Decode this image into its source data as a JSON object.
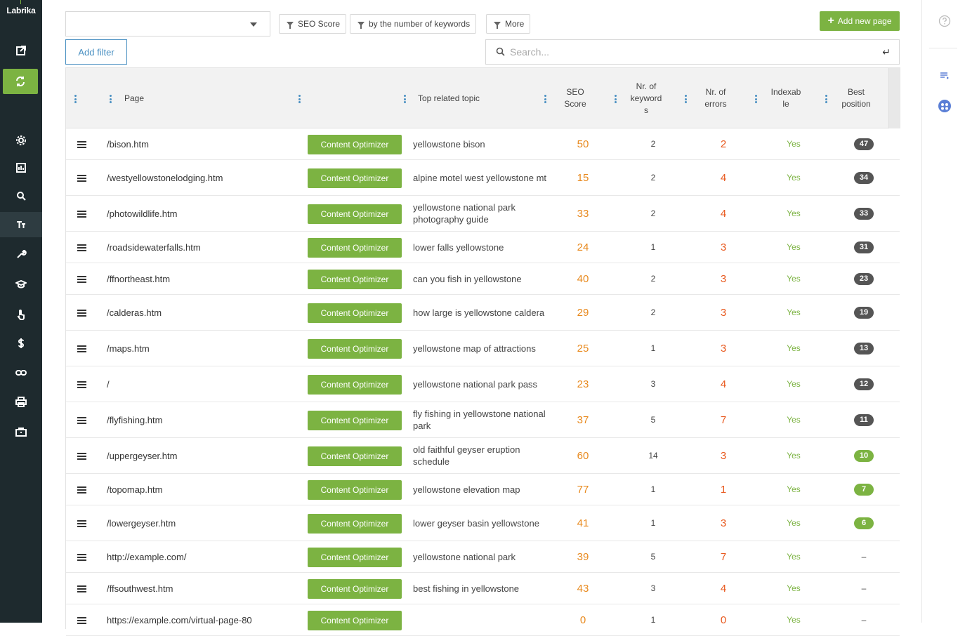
{
  "sidebar": {
    "logo": "Labrika"
  },
  "filters": {
    "select_value": "",
    "chips": [
      "SEO Score",
      "by the number of keywords",
      "More"
    ],
    "add_page_label": "Add new page",
    "add_filter_label": "Add filter",
    "search_placeholder": "Search..."
  },
  "table": {
    "columns": {
      "page": "Page",
      "topic": "Top related topic",
      "seo": "SEO Score",
      "keywords": "Nr. of keyword s",
      "errors": "Nr. of errors",
      "indexable": "Indexab le",
      "best": "Best position"
    },
    "action_label": "Content Optimizer",
    "rows": [
      {
        "page": "/bison.htm",
        "topic": "yellowstone bison",
        "seo": "50",
        "keywords": "2",
        "errors": "2",
        "indexable": "Yes",
        "best": "47",
        "best_style": "gray"
      },
      {
        "page": "/westyellowstonelodging.htm",
        "topic": "alpine motel west yellowstone mt",
        "seo": "15",
        "keywords": "2",
        "errors": "4",
        "indexable": "Yes",
        "best": "34",
        "best_style": "gray"
      },
      {
        "page": "/photowildlife.htm",
        "topic": "yellowstone national park photography guide",
        "seo": "33",
        "keywords": "2",
        "errors": "4",
        "indexable": "Yes",
        "best": "33",
        "best_style": "gray"
      },
      {
        "page": "/roadsidewaterfalls.htm",
        "topic": "lower falls yellowstone",
        "seo": "24",
        "keywords": "1",
        "errors": "3",
        "indexable": "Yes",
        "best": "31",
        "best_style": "gray"
      },
      {
        "page": "/ffnortheast.htm",
        "topic": "can you fish in yellowstone",
        "seo": "40",
        "keywords": "2",
        "errors": "3",
        "indexable": "Yes",
        "best": "23",
        "best_style": "gray"
      },
      {
        "page": "/calderas.htm",
        "topic": "how large is yellowstone caldera",
        "seo": "29",
        "keywords": "2",
        "errors": "3",
        "indexable": "Yes",
        "best": "19",
        "best_style": "gray"
      },
      {
        "page": "/maps.htm",
        "topic": "yellowstone map of attractions",
        "seo": "25",
        "keywords": "1",
        "errors": "3",
        "indexable": "Yes",
        "best": "13",
        "best_style": "gray"
      },
      {
        "page": "/",
        "topic": "yellowstone national park pass",
        "seo": "23",
        "keywords": "3",
        "errors": "4",
        "indexable": "Yes",
        "best": "12",
        "best_style": "gray"
      },
      {
        "page": "/flyfishing.htm",
        "topic": "fly fishing in yellowstone national park",
        "seo": "37",
        "keywords": "5",
        "errors": "7",
        "indexable": "Yes",
        "best": "11",
        "best_style": "gray"
      },
      {
        "page": "/uppergeyser.htm",
        "topic": "old faithful geyser eruption schedule",
        "seo": "60",
        "keywords": "14",
        "errors": "3",
        "indexable": "Yes",
        "best": "10",
        "best_style": "green"
      },
      {
        "page": "/topomap.htm",
        "topic": "yellowstone elevation map",
        "seo": "77",
        "keywords": "1",
        "errors": "1",
        "indexable": "Yes",
        "best": "7",
        "best_style": "green"
      },
      {
        "page": "/lowergeyser.htm",
        "topic": "lower geyser basin yellowstone",
        "seo": "41",
        "keywords": "1",
        "errors": "3",
        "indexable": "Yes",
        "best": "6",
        "best_style": "green"
      },
      {
        "page": "http://example.com/",
        "topic": "yellowstone national park",
        "seo": "39",
        "keywords": "5",
        "errors": "7",
        "indexable": "Yes",
        "best": "–",
        "best_style": "none"
      },
      {
        "page": "/ffsouthwest.htm",
        "topic": "best fishing in yellowstone",
        "seo": "43",
        "keywords": "3",
        "errors": "4",
        "indexable": "Yes",
        "best": "–",
        "best_style": "none"
      },
      {
        "page": "https://example.com/virtual-page-80",
        "topic": "",
        "seo": "0",
        "keywords": "1",
        "errors": "0",
        "indexable": "Yes",
        "best": "–",
        "best_style": "none"
      }
    ]
  },
  "colors": {
    "accent_green": "#7cb342",
    "sidebar_bg": "#1e2a2e",
    "link_blue": "#4a90c2",
    "seo_orange": "#e8891d",
    "error_red": "#e8581d"
  },
  "icons": {
    "sidebar": [
      "external-link-icon",
      "sync-icon",
      "gear-icon",
      "bar-chart-icon",
      "search-icon",
      "text-size-icon",
      "wrench-icon",
      "graduation-cap-icon",
      "pointer-hand-icon",
      "dollar-icon",
      "link-icon",
      "printer-icon",
      "briefcase-icon"
    ],
    "right": [
      "help-icon",
      "list-icon",
      "face-icon"
    ]
  }
}
